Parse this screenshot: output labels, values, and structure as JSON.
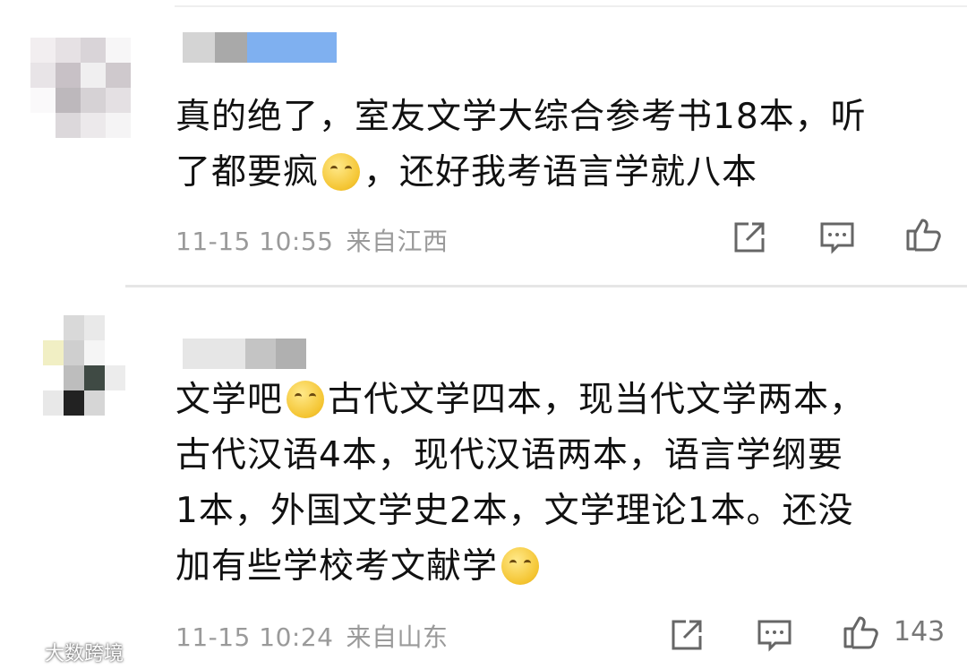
{
  "comments": [
    {
      "content_lines": [
        "真的绝了，室友文学大综合参考书18本，听",
        "了都要疯",
        "，还好我考语言学就八本"
      ],
      "time": "11-15 10:55",
      "location": "来自江西",
      "like_count": ""
    },
    {
      "content_lines": [
        "文学吧",
        "古代文学四本，现当代文学两本，",
        "古代汉语4本，现代汉语两本，语言学纲要",
        "1本，外国文学史2本，文学理论1本。还没",
        "加有些学校考文献学"
      ],
      "time": "11-15 10:24",
      "location": "来自山东",
      "like_count": "143"
    }
  ],
  "icons": {
    "share": "share-icon",
    "comment": "comment-icon",
    "like": "thumbs-up-icon"
  },
  "watermark": {
    "text": "大数跨境"
  },
  "colors": {
    "meta": "#9a9a9a",
    "divider": "#e6e6e6",
    "username_blue": "#7fb0f0"
  }
}
